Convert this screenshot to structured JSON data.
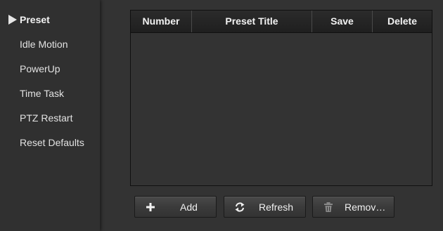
{
  "sidebar": {
    "items": [
      {
        "label": "Preset",
        "active": true
      },
      {
        "label": "Idle Motion"
      },
      {
        "label": "PowerUp"
      },
      {
        "label": "Time Task"
      },
      {
        "label": "PTZ Restart"
      },
      {
        "label": "Reset Defaults"
      }
    ]
  },
  "table": {
    "columns": [
      "Number",
      "Preset Title",
      "Save",
      "Delete"
    ],
    "rows": []
  },
  "buttons": {
    "add": {
      "label": "Add",
      "icon": "plus-icon"
    },
    "refresh": {
      "label": "Refresh",
      "icon": "refresh-icon"
    },
    "remove": {
      "label": "Remov…",
      "icon": "trash-icon"
    }
  },
  "colors": {
    "background": "#333333",
    "sidebar": "#303030",
    "header": "#1f1f1f",
    "text": "#f2f2f2"
  }
}
